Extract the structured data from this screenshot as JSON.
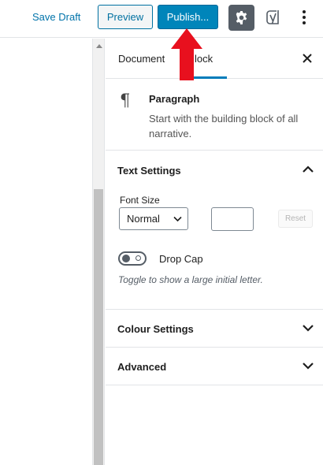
{
  "toolbar": {
    "save_draft": "Save Draft",
    "preview": "Preview",
    "publish": "Publish...",
    "settings_icon": "gear-icon",
    "yoast_icon": "yoast-icon",
    "more_icon": "vertical-ellipsis-icon"
  },
  "sidebar": {
    "tabs": [
      {
        "label": "Document"
      },
      {
        "label": "Block",
        "visible_text": "lock",
        "active": true
      }
    ],
    "block": {
      "icon": "pilcrow",
      "title": "Paragraph",
      "description": "Start with the building block of all narrative."
    },
    "text_settings": {
      "title": "Text Settings",
      "expanded": true,
      "font_size_label": "Font Size",
      "font_size_value": "Normal",
      "custom_size_value": "",
      "reset_label": "Reset",
      "drop_cap_label": "Drop Cap",
      "drop_cap_enabled": false,
      "drop_cap_help": "Toggle to show a large initial letter."
    },
    "colour_settings": {
      "title": "Colour Settings",
      "expanded": false
    },
    "advanced": {
      "title": "Advanced",
      "expanded": false
    }
  },
  "colors": {
    "accent": "#0085ba",
    "annotation_arrow": "#e8101e"
  }
}
